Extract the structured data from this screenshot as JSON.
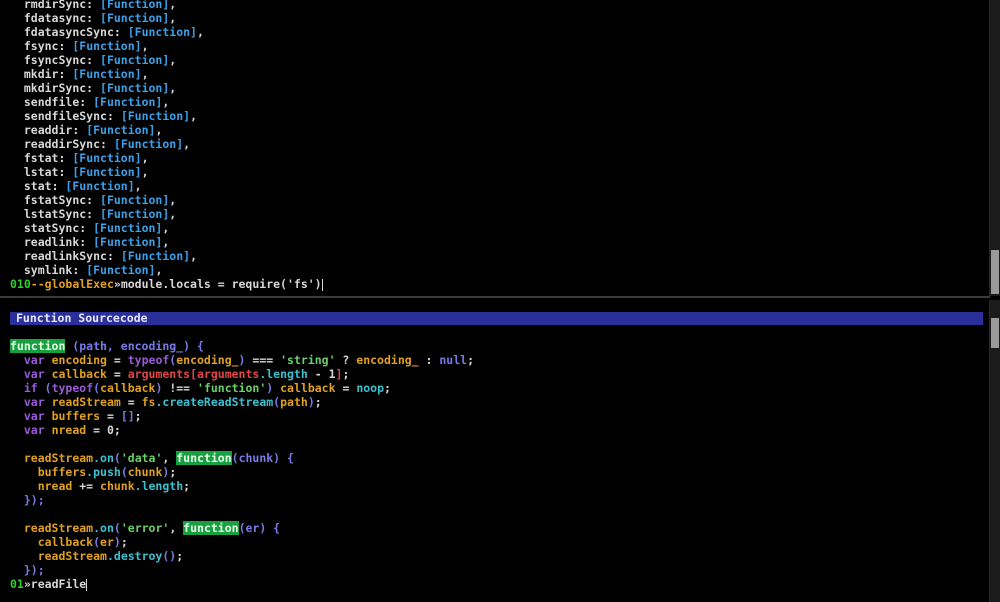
{
  "top_pane": {
    "entries": [
      {
        "key": "rmdirSync",
        "value": "[Function]"
      },
      {
        "key": "fdatasync",
        "value": "[Function]"
      },
      {
        "key": "fdatasyncSync",
        "value": "[Function]"
      },
      {
        "key": "fsync",
        "value": "[Function]"
      },
      {
        "key": "fsyncSync",
        "value": "[Function]"
      },
      {
        "key": "mkdir",
        "value": "[Function]"
      },
      {
        "key": "mkdirSync",
        "value": "[Function]"
      },
      {
        "key": "sendfile",
        "value": "[Function]"
      },
      {
        "key": "sendfileSync",
        "value": "[Function]"
      },
      {
        "key": "readdir",
        "value": "[Function]"
      },
      {
        "key": "readdirSync",
        "value": "[Function]"
      },
      {
        "key": "fstat",
        "value": "[Function]"
      },
      {
        "key": "lstat",
        "value": "[Function]"
      },
      {
        "key": "stat",
        "value": "[Function]"
      },
      {
        "key": "fstatSync",
        "value": "[Function]"
      },
      {
        "key": "lstatSync",
        "value": "[Function]"
      },
      {
        "key": "statSync",
        "value": "[Function]"
      },
      {
        "key": "readlink",
        "value": "[Function]"
      },
      {
        "key": "readlinkSync",
        "value": "[Function]"
      },
      {
        "key": "symlink",
        "value": "[Function]"
      }
    ],
    "prompt": {
      "number": "010",
      "mode": "--globalExec",
      "arrow": "»",
      "command": "module.locals = require('fs')"
    }
  },
  "bottom_pane": {
    "title": "Function Sourcecode",
    "code": {
      "l1_fn": "function",
      "l1_params": " (path, encoding_) {",
      "l2_var": "var",
      "l2_name": " encoding ",
      "l2_eq": "= ",
      "l2_typeof": "typeof",
      "l2_paren_open": "(",
      "l2_arg": "encoding_",
      "l2_paren_close": ")",
      "l2_op": " === ",
      "l2_str": "'string'",
      "l2_q": " ? ",
      "l2_arg2": "encoding_",
      "l2_colon": " : ",
      "l2_null": "null",
      "l2_semi": ";",
      "l3_var": "var",
      "l3_name": " callback ",
      "l3_eq": "= ",
      "l3_args": "arguments",
      "l3_bracket_open": "[",
      "l3_args2": "arguments",
      "l3_len": ".length",
      "l3_minus": " - ",
      "l3_one": "1",
      "l3_bracket_close": "]",
      "l3_semi": ";",
      "l4_if": "if",
      "l4_paren_open": " (",
      "l4_typeof": "typeof",
      "l4_po2": "(",
      "l4_cb": "callback",
      "l4_pc2": ")",
      "l4_op": " !== ",
      "l4_str": "'function'",
      "l4_pc": ")",
      "l4_cb2": " callback ",
      "l4_eq": "= ",
      "l4_noop": "noop",
      "l4_semi": ";",
      "l5_var": "var",
      "l5_name": " readStream ",
      "l5_eq": "= ",
      "l5_fs": "fs",
      "l5_dot": ".",
      "l5_method": "createReadStream",
      "l5_po": "(",
      "l5_path": "path",
      "l5_pc": ")",
      "l5_semi": ";",
      "l6_var": "var",
      "l6_name": " buffers ",
      "l6_eq": "= ",
      "l6_arr": "[]",
      "l6_semi": ";",
      "l7_var": "var",
      "l7_name": " nread ",
      "l7_eq": "= ",
      "l7_zero": "0",
      "l7_semi": ";",
      "l9_rs": "readStream",
      "l9_dot": ".",
      "l9_on": "on",
      "l9_po": "(",
      "l9_str": "'data'",
      "l9_comma": ", ",
      "l9_fn": "function",
      "l9_params": "(chunk) {",
      "l10_buf": "buffers",
      "l10_dot": ".",
      "l10_push": "push",
      "l10_po": "(",
      "l10_chunk": "chunk",
      "l10_pc": ")",
      "l10_semi": ";",
      "l11_nread": "nread ",
      "l11_op": "+= ",
      "l11_chunk": "chunk",
      "l11_len": ".length",
      "l11_semi": ";",
      "l12_close": "});",
      "l14_rs": "readStream",
      "l14_dot": ".",
      "l14_on": "on",
      "l14_po": "(",
      "l14_str": "'error'",
      "l14_comma": ", ",
      "l14_fn": "function",
      "l14_params": "(er) {",
      "l15_cb": "callback",
      "l15_po": "(",
      "l15_er": "er",
      "l15_pc": ")",
      "l15_semi": ";",
      "l16_rs": "readStream",
      "l16_dot": ".",
      "l16_destroy": "destroy",
      "l16_parens": "()",
      "l16_semi": ";",
      "l17_close": "});"
    },
    "prompt": {
      "number": "01",
      "arrow": "»",
      "command": "readFile"
    }
  }
}
